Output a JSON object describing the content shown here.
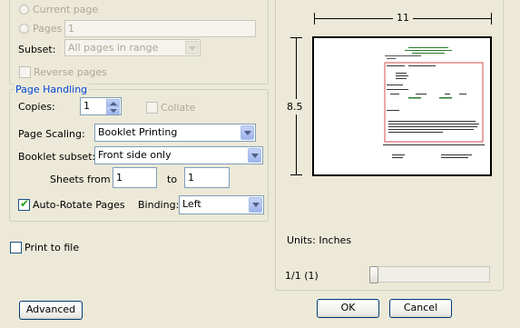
{
  "print_range": {
    "current_page_label": "Current page",
    "pages_label": "Pages",
    "pages_value": "1",
    "subset_label": "Subset:",
    "subset_value": "All pages in range",
    "reverse_pages_label": "Reverse pages"
  },
  "page_handling": {
    "title": "Page Handling",
    "copies_label": "Copies:",
    "copies_value": "1",
    "collate_label": "Collate",
    "page_scaling_label": "Page Scaling:",
    "page_scaling_value": "Booklet Printing",
    "booklet_subset_label": "Booklet subset:",
    "booklet_subset_value": "Front side only",
    "sheets_from_label": "Sheets from",
    "sheets_from_value": "1",
    "to_label": "to",
    "sheets_to_value": "1",
    "auto_rotate_label": "Auto-Rotate Pages",
    "auto_rotate_checked": true,
    "binding_label": "Binding:",
    "binding_value": "Left"
  },
  "print_to_file_label": "Print to file",
  "preview": {
    "width_label": "11",
    "height_label": "8.5",
    "units_text": "Units: Inches",
    "page_counter": "1/1 (1)"
  },
  "buttons": {
    "advanced": "Advanced",
    "ok": "OK",
    "cancel": "Cancel"
  }
}
